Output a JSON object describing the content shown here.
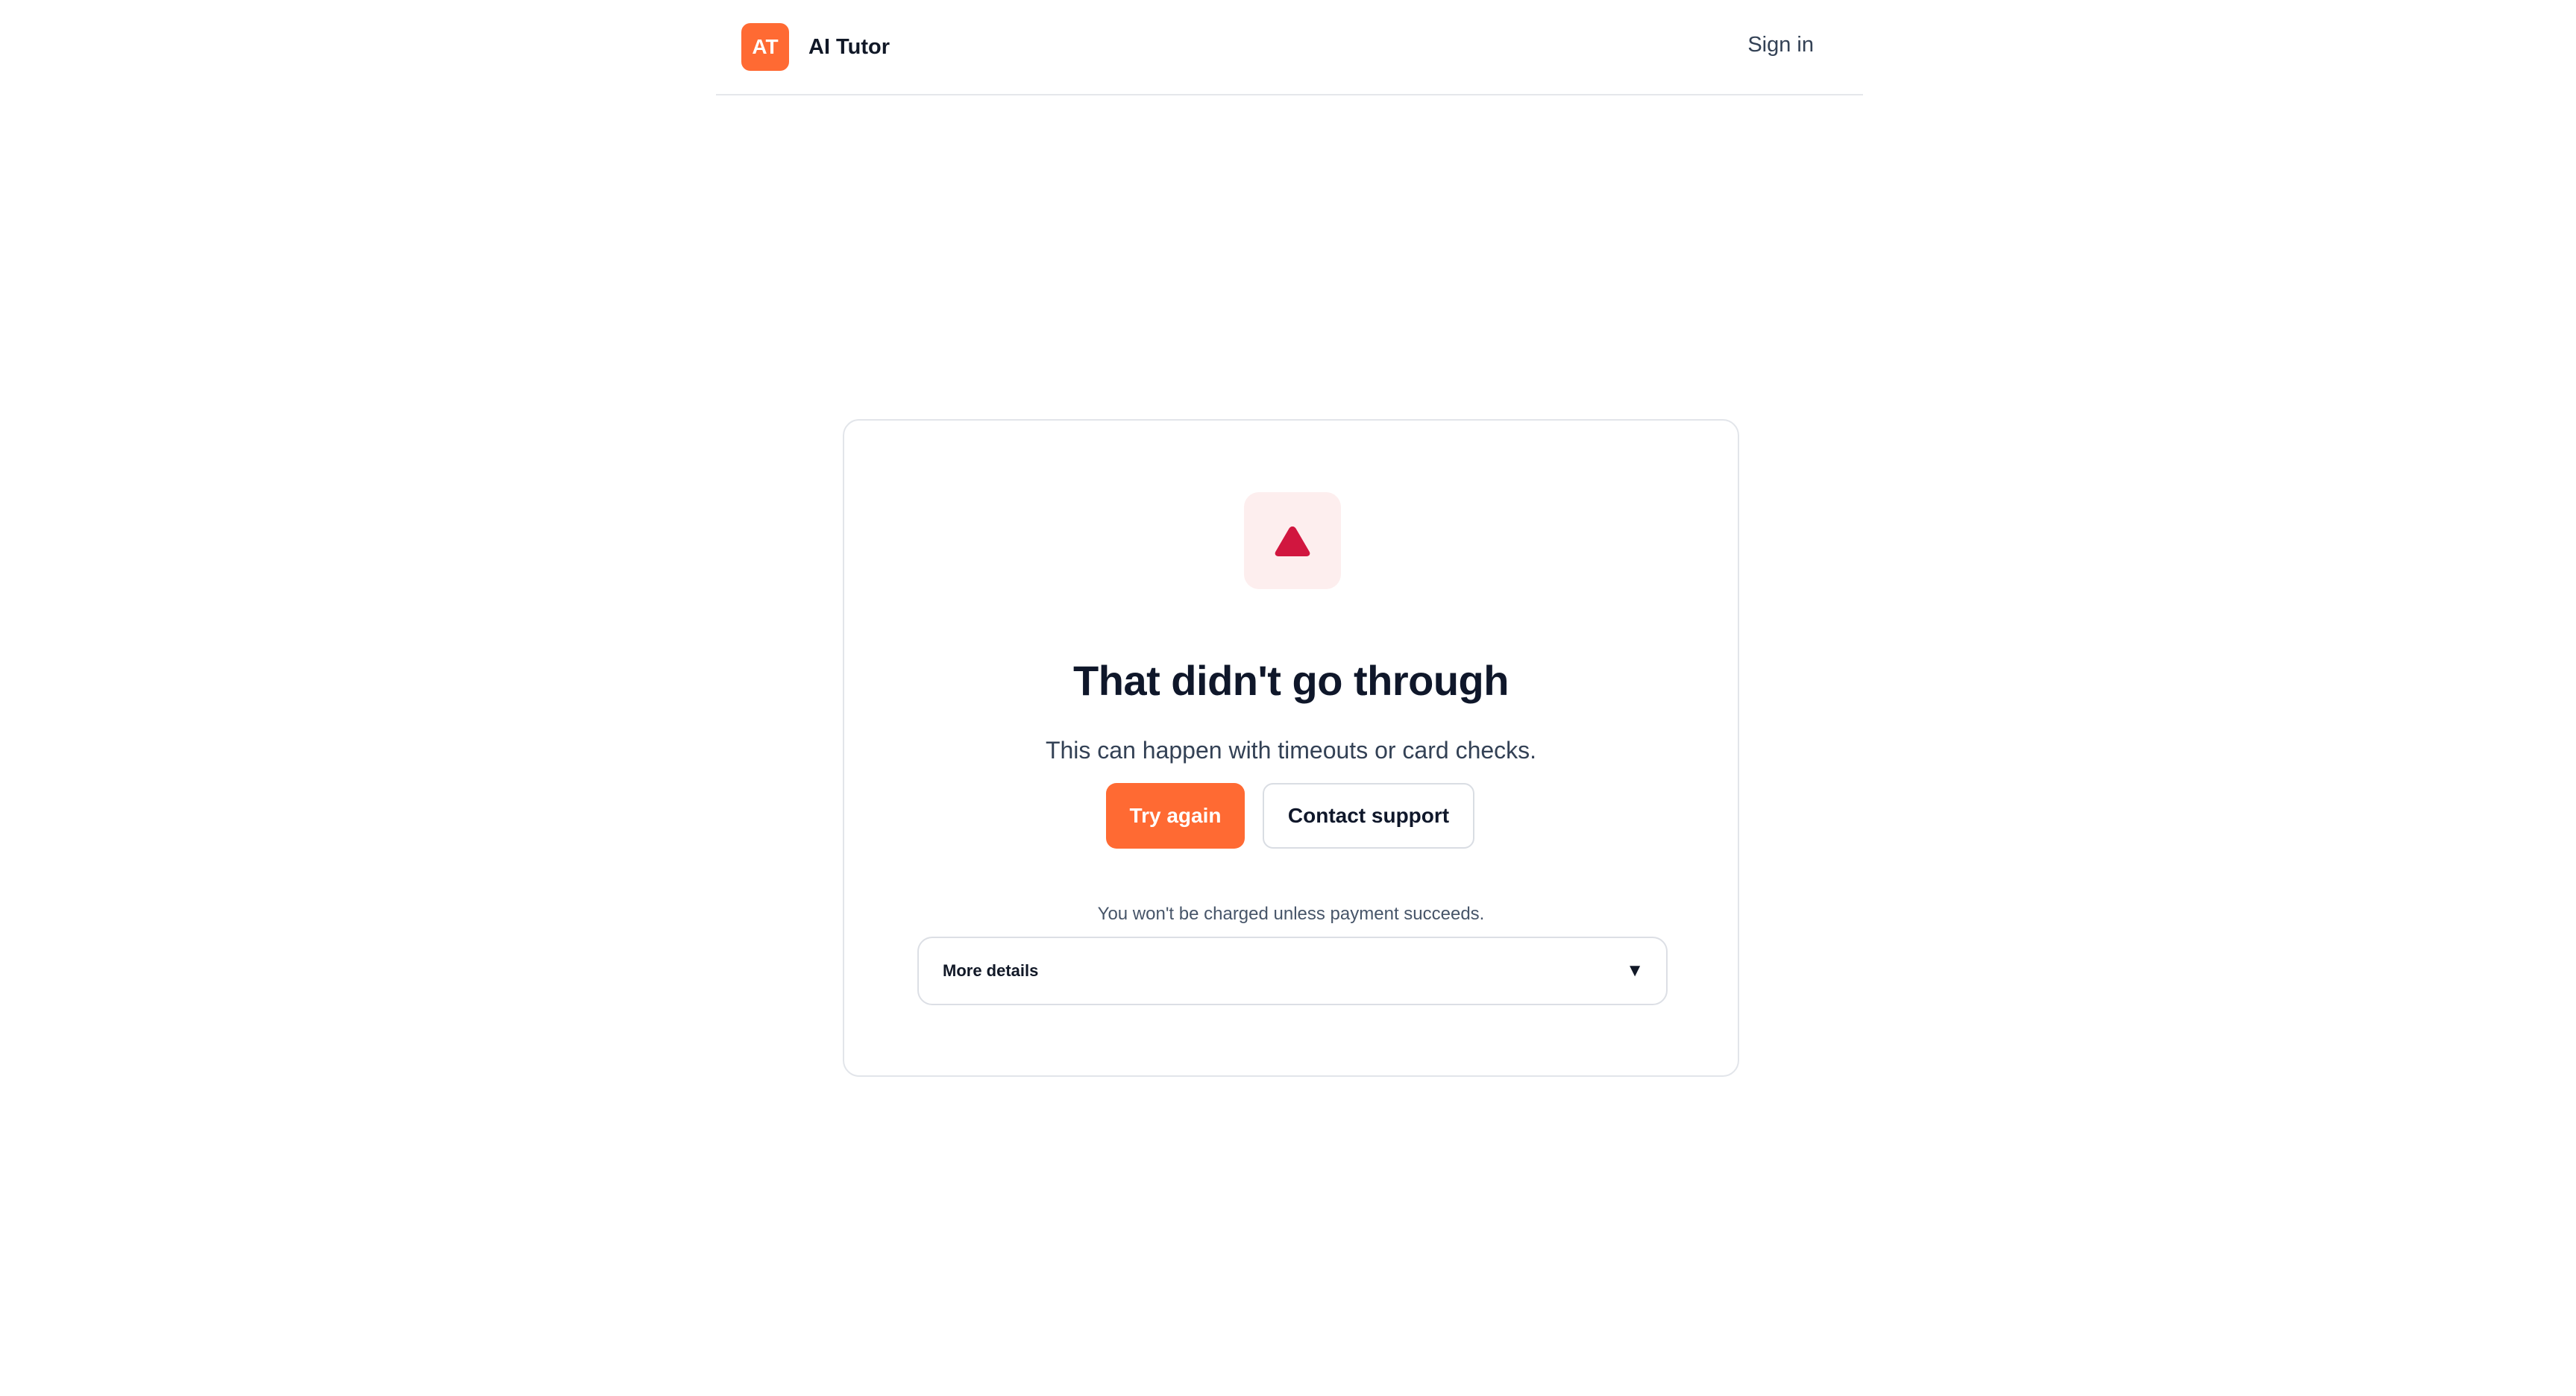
{
  "header": {
    "logo_text": "AT",
    "app_name": "AI Tutor",
    "signin_label": "Sign in"
  },
  "card": {
    "icon": "warning-triangle-icon",
    "title": "That didn't go through",
    "subtitle": "This can happen with timeouts or card checks.",
    "primary_button": "Try again",
    "secondary_button": "Contact support",
    "note": "You won't be charged unless payment succeeds.",
    "details_label": "More details",
    "details_caret": "▼"
  },
  "colors": {
    "accent": "#ff6a33",
    "alert": "#d1163f",
    "alert_bg": "#fdeeee"
  }
}
